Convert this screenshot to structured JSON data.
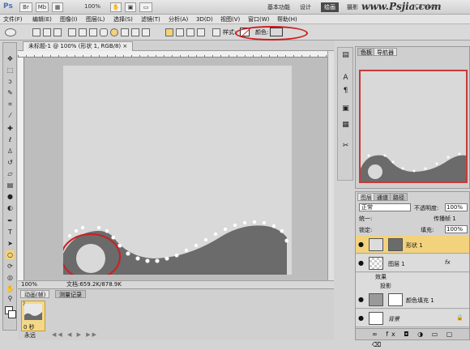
{
  "appbar": {
    "logo": "Ps",
    "buttons": [
      "Br",
      "Mb"
    ],
    "zoom": "100%",
    "workspaces": [
      "基本功能",
      "设计",
      "绘画",
      "摄影"
    ],
    "active_workspace": "绘画",
    "watermark": "www.Psjia.com",
    "cs_live": "CS Live"
  },
  "menubar": {
    "items": [
      "文件(F)",
      "编辑(E)",
      "图像(I)",
      "图层(L)",
      "选择(S)",
      "滤镜(T)",
      "分析(A)",
      "3D(D)",
      "视图(V)",
      "窗口(W)",
      "帮助(H)"
    ]
  },
  "options": {
    "style_label": "样式:",
    "color_label": "颜色:",
    "color_value": "#d8d8d8"
  },
  "document": {
    "tab_label": "未标题-1 @ 100% (形状 1, RGB/8) ×",
    "zoom": "100%",
    "doc_size": "文档:659.2K/878.9K",
    "shape_color": "#6b6b6b",
    "canvas_color": "#d9d9d9"
  },
  "animation": {
    "tabs": [
      "动画(帧)",
      "测量记录"
    ],
    "frame_number": "1",
    "frame_delay": "0 秒",
    "loop": "永远"
  },
  "navigator": {
    "tabs": [
      "色板",
      "导航器"
    ],
    "active_tab": "导航器"
  },
  "layers_panel": {
    "tabs": [
      "图层",
      "通道",
      "路径"
    ],
    "blend_mode": "正常",
    "opacity_label": "不透明度:",
    "opacity": "100%",
    "unify_label": "统一:",
    "propagate_label": "传播帧 1",
    "lock_label": "锁定:",
    "fill_label": "填充:",
    "fill": "100%",
    "layers": [
      {
        "name": "形状 1",
        "selected": true
      },
      {
        "name": "图层 1",
        "fx": "fx",
        "effects_label": "效果",
        "effect": "投影"
      },
      {
        "name": "颜色填充 1"
      },
      {
        "name": "背景"
      }
    ]
  },
  "colors": {
    "annotation_red": "#cc1f1f",
    "selected_layer": "#f2d27c"
  }
}
